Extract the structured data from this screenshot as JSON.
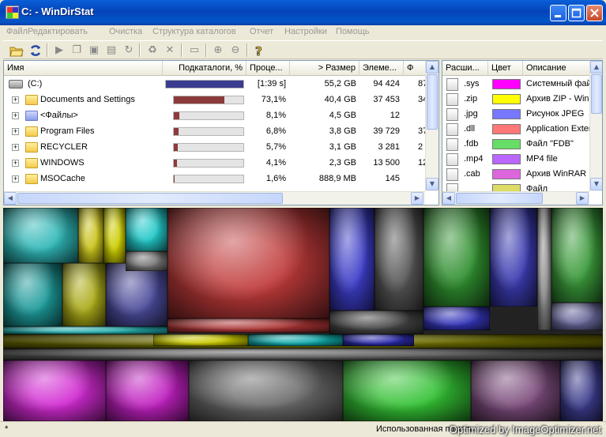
{
  "window": {
    "title": "C: - WinDirStat"
  },
  "menu": [
    "Файл",
    "Редактировать",
    "Очистка",
    "Структура каталогов",
    "Отчет",
    "Настройки",
    "Помощь"
  ],
  "tree": {
    "columns": [
      "Имя",
      "Подкаталоги, %",
      "Проце...",
      "> Размер",
      "Элеме...",
      "Ф"
    ],
    "rows": [
      {
        "name": "(C:)",
        "percent_bar": 1.0,
        "percent": "[1:39 s]",
        "size": "55,2 GB",
        "items": "94 424",
        "files": "87",
        "icon": "drive-icon",
        "bar_color": "#3b3b8f"
      },
      {
        "name": "Documents and Settings",
        "percent_bar": 0.731,
        "percent": "73,1%",
        "size": "40,4 GB",
        "items": "37 453",
        "files": "34",
        "icon": "folder-icon",
        "bar_color": "#8b3b3b"
      },
      {
        "name": "<Файлы>",
        "percent_bar": 0.081,
        "percent": "8,1%",
        "size": "4,5 GB",
        "items": "12",
        "files": "",
        "icon": "files-icon",
        "bar_color": "#8b3b3b"
      },
      {
        "name": "Program Files",
        "percent_bar": 0.068,
        "percent": "6,8%",
        "size": "3,8 GB",
        "items": "39 729",
        "files": "37",
        "icon": "folder-icon",
        "bar_color": "#8b3b3b"
      },
      {
        "name": "RECYCLER",
        "percent_bar": 0.057,
        "percent": "5,7%",
        "size": "3,1 GB",
        "items": "3 281",
        "files": "2",
        "icon": "folder-icon",
        "bar_color": "#8b3b3b"
      },
      {
        "name": "WINDOWS",
        "percent_bar": 0.041,
        "percent": "4,1%",
        "size": "2,3 GB",
        "items": "13 500",
        "files": "12",
        "icon": "folder-icon",
        "bar_color": "#8b3b3b"
      },
      {
        "name": "MSOCache",
        "percent_bar": 0.016,
        "percent": "1,6%",
        "size": "888,9 MB",
        "items": "145",
        "files": "",
        "icon": "folder-icon",
        "bar_color": "#8b3b3b"
      }
    ]
  },
  "extensions": {
    "columns": [
      "Расши...",
      "Цвет",
      "Описание"
    ],
    "rows": [
      {
        "ext": ".sys",
        "color": "#ff00ff",
        "desc": "Системный фай"
      },
      {
        "ext": ".zip",
        "color": "#ffff00",
        "desc": "Архив ZIP - Win"
      },
      {
        "ext": ".jpg",
        "color": "#7777ff",
        "desc": "Рисунок JPEG"
      },
      {
        "ext": ".dll",
        "color": "#ff7777",
        "desc": "Application Exter"
      },
      {
        "ext": ".fdb",
        "color": "#66dd66",
        "desc": "Файл \"FDB\""
      },
      {
        "ext": ".mp4",
        "color": "#bb66ff",
        "desc": "MP4 file"
      },
      {
        "ext": ".cab",
        "color": "#dd66dd",
        "desc": "Архив WinRAR"
      },
      {
        "ext": "",
        "color": "#dddd66",
        "desc": "Файл"
      }
    ]
  },
  "status": {
    "left": "*",
    "right": "Использованная память:"
  },
  "watermark": "Optimized by ImageOptimizer.net",
  "colors": {
    "titlebar": "#0355c9",
    "selection_bar": "#3b3b8f"
  }
}
